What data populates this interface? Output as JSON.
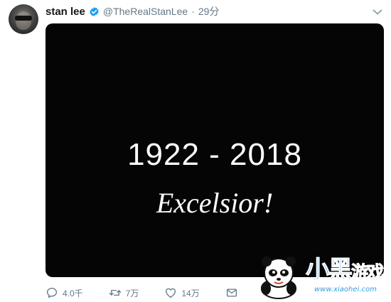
{
  "tweet": {
    "author": {
      "name": "stan lee",
      "handle": "@TheRealStanLee",
      "separator": "·",
      "time": "29分"
    },
    "media": {
      "years": "1922 - 2018",
      "motto": "Excelsior!"
    },
    "actions": {
      "reply_count": "4.0千",
      "retweet_count": "7万",
      "like_count": "14万"
    }
  },
  "watermark": {
    "logo_text": "小黑",
    "logo_suffix": "游戏",
    "url": "www.xiaohei.com"
  },
  "colors": {
    "verified": "#1da1f2",
    "icon": "#657786",
    "media_bg": "#050505"
  }
}
